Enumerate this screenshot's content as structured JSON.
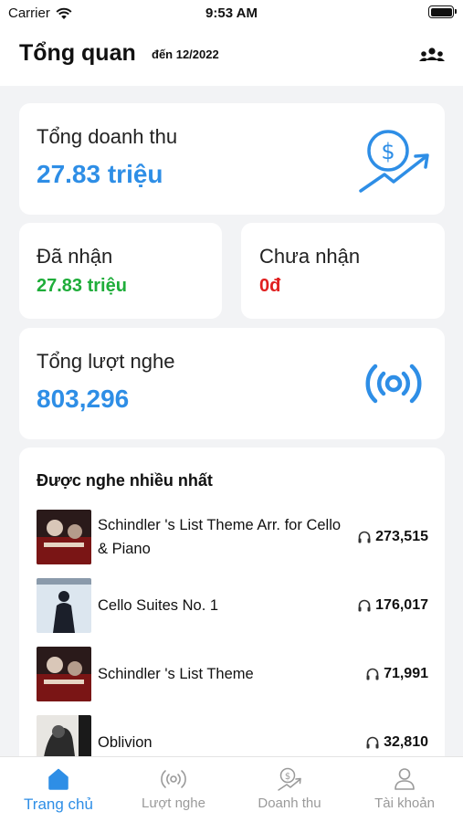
{
  "status_bar": {
    "carrier": "Carrier",
    "time": "9:53 AM"
  },
  "header": {
    "title": "Tổng quan",
    "subtitle": "đến 12/2022",
    "icon": "users-icon"
  },
  "revenue": {
    "label": "Tổng doanh thu",
    "value": "27.83 triệu",
    "icon": "revenue-growth-icon"
  },
  "received": {
    "label": "Đã nhận",
    "value": "27.83 triệu"
  },
  "pending": {
    "label": "Chưa nhận",
    "value": "0đ"
  },
  "listens": {
    "label": "Tổng lượt nghe",
    "value": "803,296",
    "icon": "broadcast-icon"
  },
  "top_tracks": {
    "title": "Được nghe nhiều nhất",
    "items": [
      {
        "name": "Schindler 's List Theme Arr. for Cello & Piano",
        "count": "273,515"
      },
      {
        "name": "Cello Suites No. 1",
        "count": "176,017"
      },
      {
        "name": "Schindler 's List Theme",
        "count": "71,991"
      },
      {
        "name": "Oblivion",
        "count": "32,810"
      }
    ]
  },
  "tabs": [
    {
      "label": "Trang chủ",
      "icon": "home-icon",
      "active": true
    },
    {
      "label": "Lượt nghe",
      "icon": "broadcast-icon",
      "active": false
    },
    {
      "label": "Doanh thu",
      "icon": "revenue-icon",
      "active": false
    },
    {
      "label": "Tài khoản",
      "icon": "account-icon",
      "active": false
    }
  ],
  "colors": {
    "accent": "#2e8ee6",
    "positive": "#1fad3a",
    "negative": "#e02020",
    "background": "#f2f3f5"
  }
}
